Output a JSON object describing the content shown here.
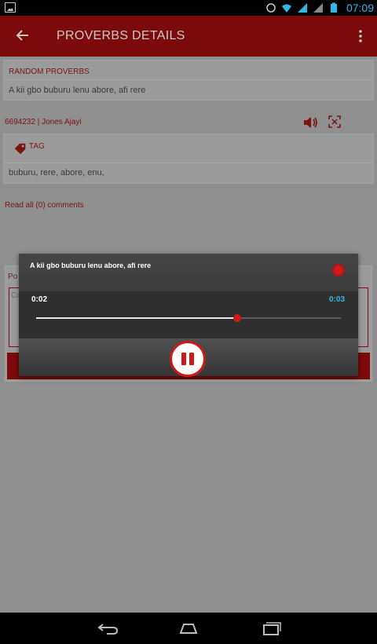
{
  "status_bar": {
    "time": "07:09"
  },
  "app_bar": {
    "title": "PROVERBS DETAILS"
  },
  "random_card": {
    "label": "RANDOM PROVERBS",
    "text": "A kii gbo buburu lenu abore, afi rere"
  },
  "meta": {
    "text": "6694232 | Jones Ajayi"
  },
  "tag_card": {
    "label": "TAG",
    "tags": "buburu, rere, abore, enu,"
  },
  "comments": {
    "read_all": "Read all (0) comments"
  },
  "form": {
    "label": "Po",
    "textarea_placeholder": "Co"
  },
  "player": {
    "title": "A kii gbo buburu lenu abore, afi rere",
    "current_time": "0:02",
    "total_time": "0:03",
    "progress": 0.66
  },
  "colors": {
    "accent": "#d11818",
    "time_blue": "#33b5e5",
    "app_bar": "#b71c1c"
  }
}
